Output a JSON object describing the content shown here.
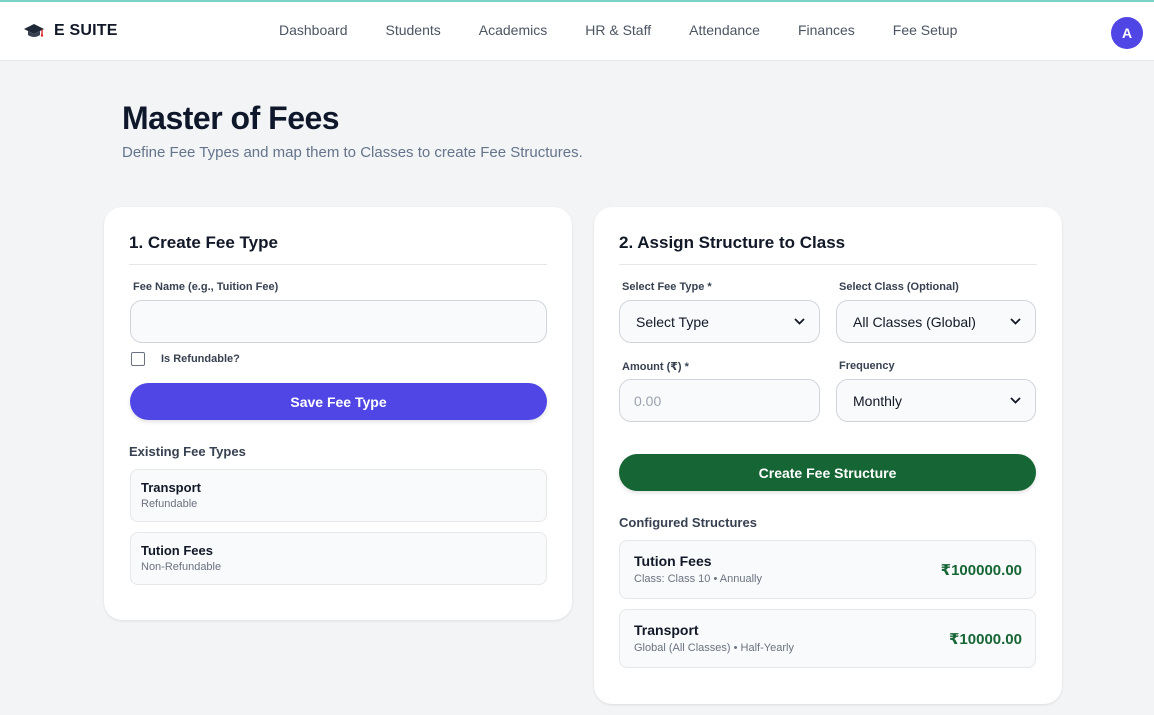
{
  "brand": {
    "name": "E SUITE",
    "icon": "graduation-cap-icon"
  },
  "nav": {
    "items": [
      "Dashboard",
      "Students",
      "Academics",
      "HR & Staff",
      "Attendance",
      "Finances",
      "Fee Setup"
    ]
  },
  "user": {
    "avatar_initial": "A"
  },
  "header": {
    "title": "Master of Fees",
    "subtitle": "Define Fee Types and map them to Classes to create Fee Structures."
  },
  "create_fee_type": {
    "heading": "1. Create Fee Type",
    "fee_name_label": "Fee Name (e.g., Tuition Fee)",
    "fee_name_value": "",
    "fee_name_placeholder": "",
    "refundable_label": "Is Refundable?",
    "refundable_checked": false,
    "save_button": "Save Fee Type",
    "existing_title": "Existing Fee Types",
    "existing": [
      {
        "name": "Transport",
        "status": "Refundable"
      },
      {
        "name": "Tution Fees",
        "status": "Non-Refundable"
      }
    ]
  },
  "assign_structure": {
    "heading": "2. Assign Structure to Class",
    "fee_type_label": "Select Fee Type *",
    "fee_type_selected": "Select Type",
    "class_label": "Select Class (Optional)",
    "class_selected": "All Classes (Global)",
    "amount_label": "Amount (₹) *",
    "amount_value": "",
    "amount_placeholder": "0.00",
    "frequency_label": "Frequency",
    "frequency_selected": "Monthly",
    "create_button": "Create Fee Structure",
    "configured_title": "Configured Structures",
    "structures": [
      {
        "name": "Tution Fees",
        "details": "Class: Class 10 • Annually",
        "amount": "₹100000.00"
      },
      {
        "name": "Transport",
        "details": "Global (All Classes) • Half-Yearly",
        "amount": "₹10000.00"
      }
    ]
  },
  "colors": {
    "primary": "#4f46e5",
    "success": "#166534",
    "background": "#f3f4f6"
  }
}
